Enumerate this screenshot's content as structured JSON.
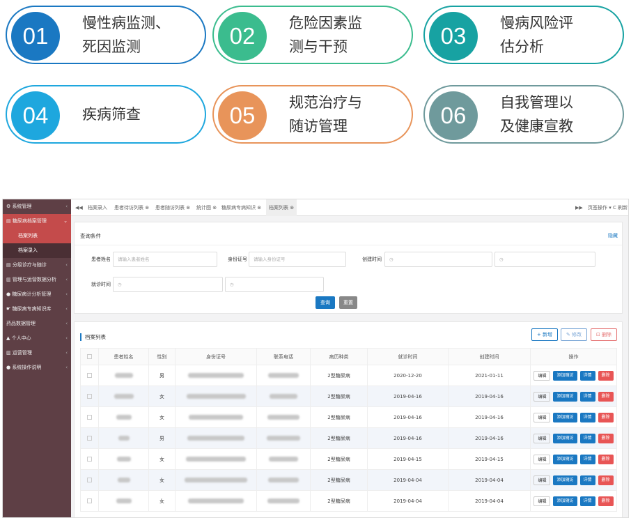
{
  "features": [
    {
      "num": "01",
      "text": "慢性病监测、\n死因监测",
      "color": "#1a78c2"
    },
    {
      "num": "02",
      "text": "危险因素监\n测与干预",
      "color": "#3bbc8e"
    },
    {
      "num": "03",
      "text": "慢病风险评\n估分析",
      "color": "#17a2a2"
    },
    {
      "num": "04",
      "text": "疾病筛查",
      "color": "#1ea7de"
    },
    {
      "num": "05",
      "text": "规范治疗与\n随访管理",
      "color": "#e8945a"
    },
    {
      "num": "06",
      "text": "自我管理以\n及健康宣教",
      "color": "#6f9a9c"
    }
  ],
  "sidebar": {
    "items": [
      {
        "label": "⚙ 系统管理"
      },
      {
        "label": "▤ 糖尿病档案管理"
      },
      {
        "label": "档案列表"
      },
      {
        "label": "档案录入"
      },
      {
        "label": "▤ 分级诊疗与随诊"
      },
      {
        "label": "▥ 管理与运营数据分析"
      },
      {
        "label": "● 糖尿病计分析管理"
      },
      {
        "label": "☛ 糖尿病专病知识库"
      },
      {
        "label": "药品数据管理"
      },
      {
        "label": "▲ 个人中心"
      },
      {
        "label": "▥ 运营管理"
      },
      {
        "label": "● 系统操作说明"
      }
    ]
  },
  "tabs": {
    "items": [
      "档案录入",
      "患者待访列表 ⊗",
      "患者随访列表 ⊗",
      "统计图 ⊗",
      "糖尿病专病知识 ⊗",
      "档案列表 ⊗"
    ],
    "right_menu": "页签操作 ▾",
    "refresh": "C 刷新",
    "prev": "◀◀",
    "next": "▶▶"
  },
  "query": {
    "title": "查询条件",
    "hide": "隐藏",
    "name_label": "患者姓名",
    "name_placeholder": "请输入患者姓名",
    "id_label": "身份证号",
    "id_placeholder": "请输入身份证号",
    "created_label": "创建时间",
    "visit_label": "就诊时间",
    "search": "查询",
    "reset": "重置"
  },
  "list": {
    "title": "档案列表",
    "add": "+ 新增",
    "edit": "✎ 修改",
    "delete": "⊡ 删除",
    "columns": [
      "",
      "患者姓名",
      "性别",
      "身份证号",
      "联系电话",
      "病历种类",
      "就诊时间",
      "创建时间",
      "操作"
    ],
    "actions": {
      "edit": "编辑",
      "followup": "添加随访",
      "detail": "详情",
      "remove": "删除"
    },
    "rows": [
      {
        "gender": "男",
        "type": "2型糖尿病",
        "visit": "2020-12-20",
        "created": "2021-01-11"
      },
      {
        "gender": "女",
        "type": "2型糖尿病",
        "visit": "2019-04-16",
        "created": "2019-04-16"
      },
      {
        "gender": "女",
        "type": "2型糖尿病",
        "visit": "2019-04-16",
        "created": "2019-04-16"
      },
      {
        "gender": "男",
        "type": "2型糖尿病",
        "visit": "2019-04-16",
        "created": "2019-04-16"
      },
      {
        "gender": "女",
        "type": "2型糖尿病",
        "visit": "2019-04-15",
        "created": "2019-04-15"
      },
      {
        "gender": "女",
        "type": "2型糖尿病",
        "visit": "2019-04-04",
        "created": "2019-04-04"
      },
      {
        "gender": "女",
        "type": "2型糖尿病",
        "visit": "2019-04-04",
        "created": "2019-04-04"
      }
    ]
  }
}
